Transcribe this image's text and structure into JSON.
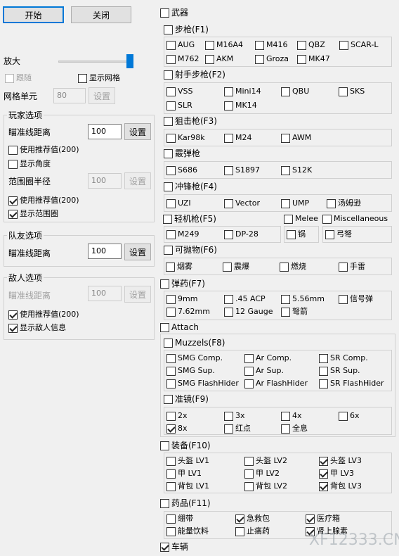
{
  "left": {
    "start": "开始",
    "close": "关闭",
    "zoom": "放大",
    "follow": "跟随",
    "show_grid": "显示网格",
    "grid_cell": "网格单元",
    "grid_value": "80",
    "set": "设置",
    "player_group": "玩家选项",
    "aim_distance": "瞄准线距离",
    "player_aim_value": "100",
    "use_recommend": "使用推荐值(200)",
    "show_angle": "显示角度",
    "range_radius": "范围圈半径",
    "range_value": "100",
    "show_range": "显示范围圈",
    "team_group": "队友选项",
    "team_aim_value": "100",
    "enemy_group": "敌人选项",
    "enemy_aim_value": "100",
    "show_enemy_info": "显示敌人信息"
  },
  "right": {
    "weapons": "武器",
    "rifles": "步枪(F1)",
    "rifle_items": [
      "AUG",
      "M16A4",
      "M416",
      "QBZ",
      "SCAR-L",
      "M762",
      "AKM",
      "Groza",
      "MK47"
    ],
    "dmr": "射手步枪(F2)",
    "dmr_items": [
      "VSS",
      "Mini14",
      "QBU",
      "SKS",
      "SLR",
      "MK14"
    ],
    "sniper": "狙击枪(F3)",
    "sniper_items": [
      "Kar98k",
      "M24",
      "AWM"
    ],
    "shotgun": "霰弹枪",
    "shotgun_items": [
      "S686",
      "S1897",
      "S12K"
    ],
    "smg": "冲锋枪(F4)",
    "smg_items": [
      "UZI",
      "Vector",
      "UMP",
      "汤姆逊"
    ],
    "lmg": "轻机枪(F5)",
    "lmg_items": [
      "M249",
      "DP-28"
    ],
    "melee": "Melee",
    "misc": "Miscellaneous",
    "pan": "锅",
    "crossbow": "弓弩",
    "throwables": "可抛物(F6)",
    "throw_items": [
      "烟雾",
      "震爆",
      "燃烧",
      "手雷"
    ],
    "ammo": "弹药(F7)",
    "ammo_items": [
      "9mm",
      ".45 ACP",
      "5.56mm",
      "信号弹",
      "7.62mm",
      "12 Gauge",
      "弩箭"
    ],
    "attach": "Attach",
    "muzzels": "Muzzels(F8)",
    "muzzle_items": [
      "SMG Comp.",
      "Ar Comp.",
      "SR Comp.",
      "SMG Sup.",
      "Ar Sup.",
      "SR Sup.",
      "SMG FlashHider",
      "Ar FlashHider",
      "SR FlashHider"
    ],
    "scope": "准镜(F9)",
    "scope_items": [
      "2x",
      "3x",
      "4x",
      "6x",
      "8x",
      "红点",
      "全息"
    ],
    "equipment": "装备(F10)",
    "equip_items": [
      "头盔 LV1",
      "头盔 LV2",
      "头盔 LV3",
      "甲 LV1",
      "甲 LV2",
      "甲 LV3",
      "背包 LV1",
      "背包 LV2",
      "背包 LV3"
    ],
    "medicine": "药品(F11)",
    "med_items": [
      "绷带",
      "急救包",
      "医疗箱",
      "能量饮料",
      "止痛药",
      "肾上腺素"
    ],
    "vehicle": "车辆"
  },
  "watermark": "XF12333.CN"
}
